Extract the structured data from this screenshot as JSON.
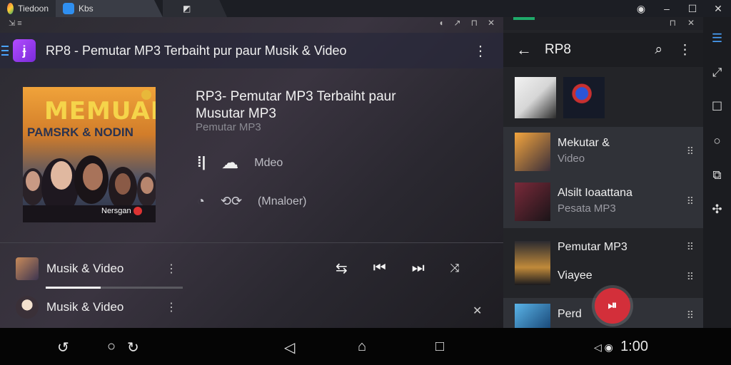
{
  "window": {
    "tabs": [
      {
        "label": "Tiedoon"
      },
      {
        "label": "Kbs"
      },
      {
        "label": ""
      }
    ],
    "controls": [
      "target-icon",
      "minimize-icon",
      "maximize-icon",
      "close-icon"
    ]
  },
  "player": {
    "app_title": "RP8 - Pemutar MP3 Terbaiht pur paur Musik & Video",
    "cover": {
      "line1": "MEMUAK",
      "line2": "PAMSRK & NODIN",
      "line3": "Nersgan"
    },
    "now_playing": {
      "title": "RP3- Pemutar MP3 Terbaiht paur Musutar MP3",
      "subtitle": "Pemutar MP3",
      "row1_label": "Mdeo",
      "row2_label": "(Mnaloer)"
    },
    "queue": [
      {
        "label": "Musik & Video",
        "progress": 0.4
      },
      {
        "label": "Musik & Video"
      }
    ]
  },
  "library": {
    "title": "RP8",
    "items": [
      {
        "title": "Mekutar &",
        "subtitle": "Video"
      },
      {
        "title": "Alsilt Ioaattana",
        "subtitle": "Pesata MP3"
      },
      {
        "title": "Pemutar MP3",
        "subtitle": ""
      },
      {
        "title": "Viayee",
        "subtitle": ""
      },
      {
        "title": "Perd",
        "subtitle": ""
      }
    ]
  },
  "status": {
    "clock": "1:00"
  }
}
